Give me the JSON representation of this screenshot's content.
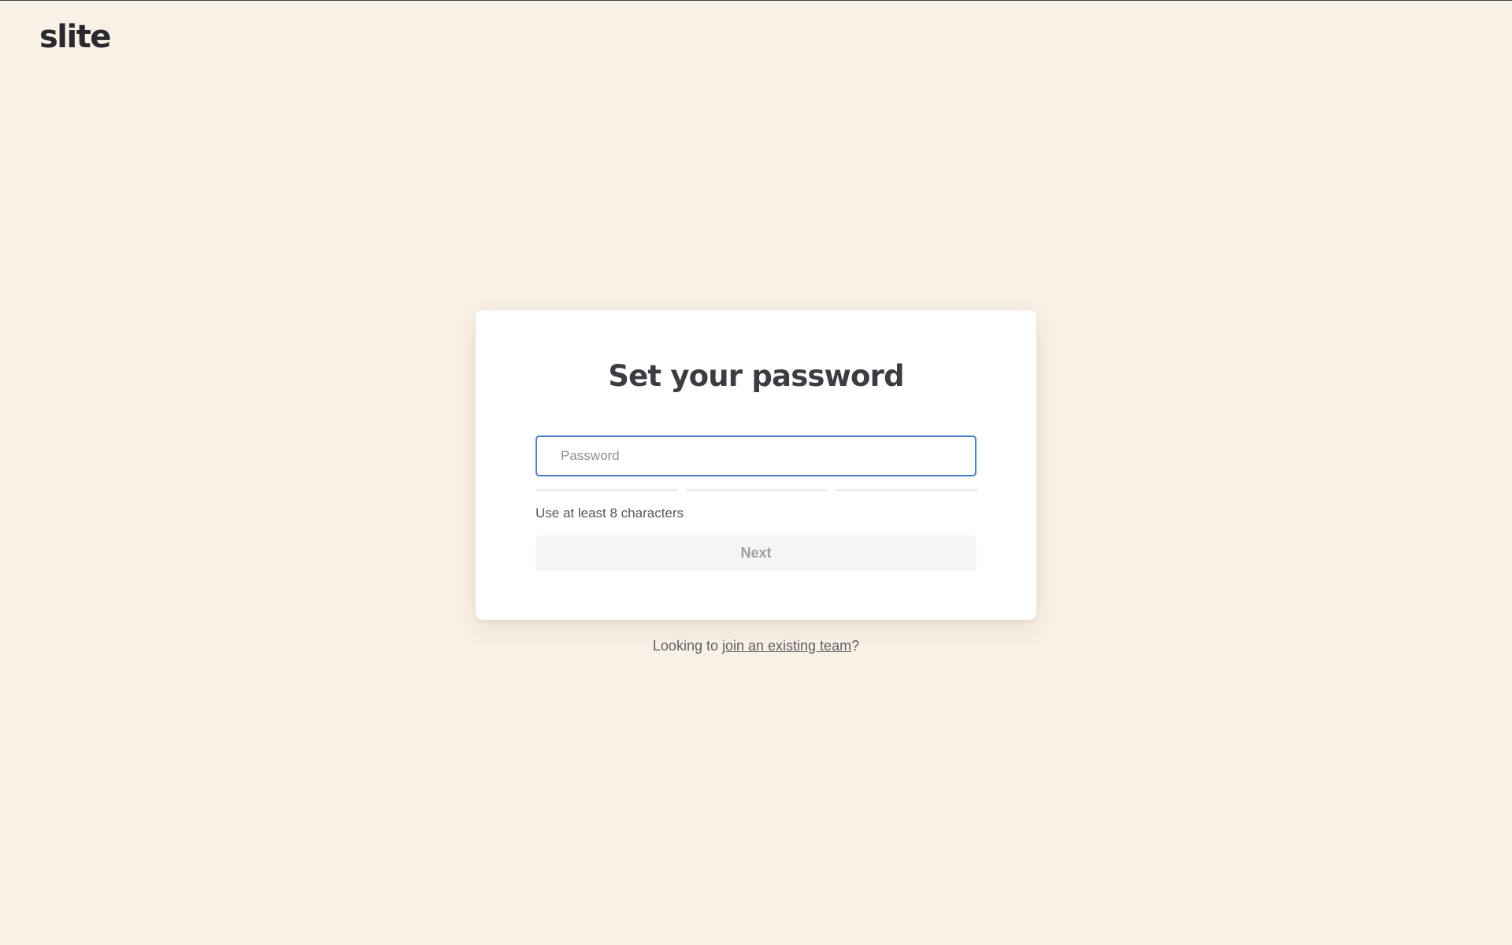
{
  "brand": {
    "logo_text": "slite"
  },
  "card": {
    "title": "Set your password",
    "password_field": {
      "placeholder": "Password",
      "value": ""
    },
    "strength_meter": {
      "segments": 3,
      "filled": 0
    },
    "hint": "Use at least 8 characters",
    "next_label": "Next"
  },
  "footer": {
    "prefix": "Looking to ",
    "link_text": "join an existing team",
    "suffix": "?"
  },
  "colors": {
    "background": "#f9f0e6",
    "input_focus_border": "#4a7fc8",
    "disabled_button_bg": "#f5f5f6"
  }
}
